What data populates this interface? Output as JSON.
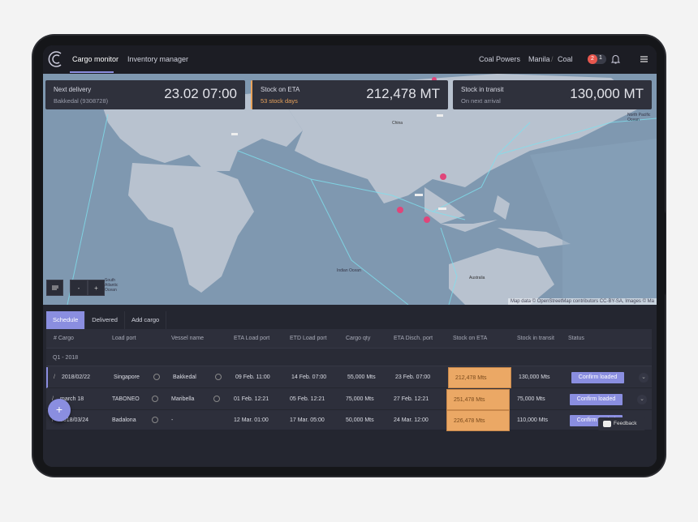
{
  "header": {
    "tabs": [
      {
        "label": "Cargo monitor",
        "active": true
      },
      {
        "label": "Inventory manager"
      }
    ],
    "company": "Coal Powers",
    "location": "Manila",
    "separator": "/",
    "commodity": "Coal",
    "notifications": {
      "alerts": "2",
      "count": "1"
    },
    "icons": [
      "logo",
      "bell-icon",
      "menu-icon"
    ]
  },
  "cards": [
    {
      "title": "Next delivery",
      "subtitle": "Bakkedal (9308728)",
      "value": "23.02 07:00"
    },
    {
      "title": "Stock on ETA",
      "subtitle": "53 stock days",
      "value": "212,478 MT",
      "accent": "#e9a25a"
    },
    {
      "title": "Stock in transit",
      "subtitle": "On next arrival",
      "value": "130,000 MT"
    }
  ],
  "map": {
    "labels": {
      "indian": "Indian Ocean",
      "pacific": "North Pacific Ocean",
      "atlantic": "South Atlantic Ocean",
      "china": "China",
      "australia": "Australia"
    },
    "attribution": "Map data © OpenStreetMap contributors CC-BY-SA, Images © Ma",
    "controls": {
      "zoom_out": "-",
      "zoom_in": "+"
    }
  },
  "panel": {
    "tabs": [
      {
        "label": "Schedule",
        "active": true
      },
      {
        "label": "Delivered"
      },
      {
        "label": "Add cargo"
      }
    ],
    "columns": [
      "# Cargo",
      "Load port",
      "Vessel name",
      "ETA Load port",
      "ETD Load port",
      "Cargo qty",
      "ETA Disch. port",
      "Stock on ETA",
      "Stock in transit",
      "Status"
    ],
    "group": "Q1 - 2018",
    "rows": [
      {
        "cargo": "2018/02/22",
        "load_port": "Singapore",
        "vessel": "Bakkedal",
        "eta_load": "09 Feb. 11:00",
        "etd_load": "14 Feb. 07:00",
        "qty": "55,000 Mts",
        "eta_disch": "23 Feb. 07:00",
        "stock_eta": "212,478 Mts",
        "transit": "130,000 Mts",
        "action": "Confirm loaded"
      },
      {
        "cargo": "march 18",
        "load_port": "TABONEO",
        "vessel": "Maribella",
        "eta_load": "01 Feb. 12:21",
        "etd_load": "05 Feb. 12:21",
        "qty": "75,000 Mts",
        "eta_disch": "27 Feb. 12:21",
        "stock_eta": "251,478 Mts",
        "transit": "75,000 Mts",
        "action": "Confirm loaded"
      },
      {
        "cargo": "2018/03/24",
        "load_port": "Badalona",
        "vessel": "-",
        "eta_load": "12 Mar. 01:00",
        "etd_load": "17 Mar. 05:00",
        "qty": "50,000 Mts",
        "eta_disch": "24 Mar. 12:00",
        "stock_eta": "226,478 Mts",
        "transit": "110,000 Mts",
        "action": "Confirm loaded"
      }
    ],
    "fab": "+",
    "feedback": "Feedback"
  },
  "colors": {
    "accent": "#8a8ee0",
    "stock_highlight": "#eba865",
    "alert": "#e8574e"
  }
}
